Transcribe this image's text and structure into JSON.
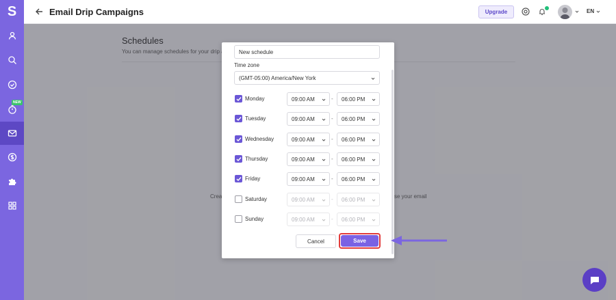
{
  "header": {
    "title": "Email Drip Campaigns",
    "upgrade_label": "Upgrade",
    "language": "EN"
  },
  "sidebar": {
    "logo": "S",
    "new_badge": "NEW",
    "items": [
      {
        "icon": "user-icon"
      },
      {
        "icon": "search-icon"
      },
      {
        "icon": "check-circle-icon"
      },
      {
        "icon": "timer-icon"
      },
      {
        "icon": "mail-icon",
        "active": true
      },
      {
        "icon": "dollar-icon"
      },
      {
        "icon": "puzzle-icon"
      },
      {
        "icon": "grid-icon"
      }
    ]
  },
  "page": {
    "title": "Schedules",
    "subtitle": "You can manage schedules for your drip an",
    "empty_left": "Crea",
    "empty_right": "se your email"
  },
  "modal": {
    "name_value": "New schedule",
    "timezone_label": "Time zone",
    "timezone_value": "(GMT-05:00) America/New York",
    "days": [
      {
        "label": "Monday",
        "checked": true,
        "from": "09:00 AM",
        "to": "06:00 PM"
      },
      {
        "label": "Tuesday",
        "checked": true,
        "from": "09:00 AM",
        "to": "06:00 PM"
      },
      {
        "label": "Wednesday",
        "checked": true,
        "from": "09:00 AM",
        "to": "06:00 PM"
      },
      {
        "label": "Thursday",
        "checked": true,
        "from": "09:00 AM",
        "to": "06:00 PM"
      },
      {
        "label": "Friday",
        "checked": true,
        "from": "09:00 AM",
        "to": "06:00 PM"
      },
      {
        "label": "Saturday",
        "checked": false,
        "from": "09:00 AM",
        "to": "06:00 PM"
      },
      {
        "label": "Sunday",
        "checked": false,
        "from": "09:00 AM",
        "to": "06:00 PM"
      }
    ],
    "dash": "-",
    "cancel_label": "Cancel",
    "save_label": "Save"
  },
  "colors": {
    "accent": "#7b66e0",
    "highlight": "#e23b3b",
    "online": "#21c07a"
  }
}
